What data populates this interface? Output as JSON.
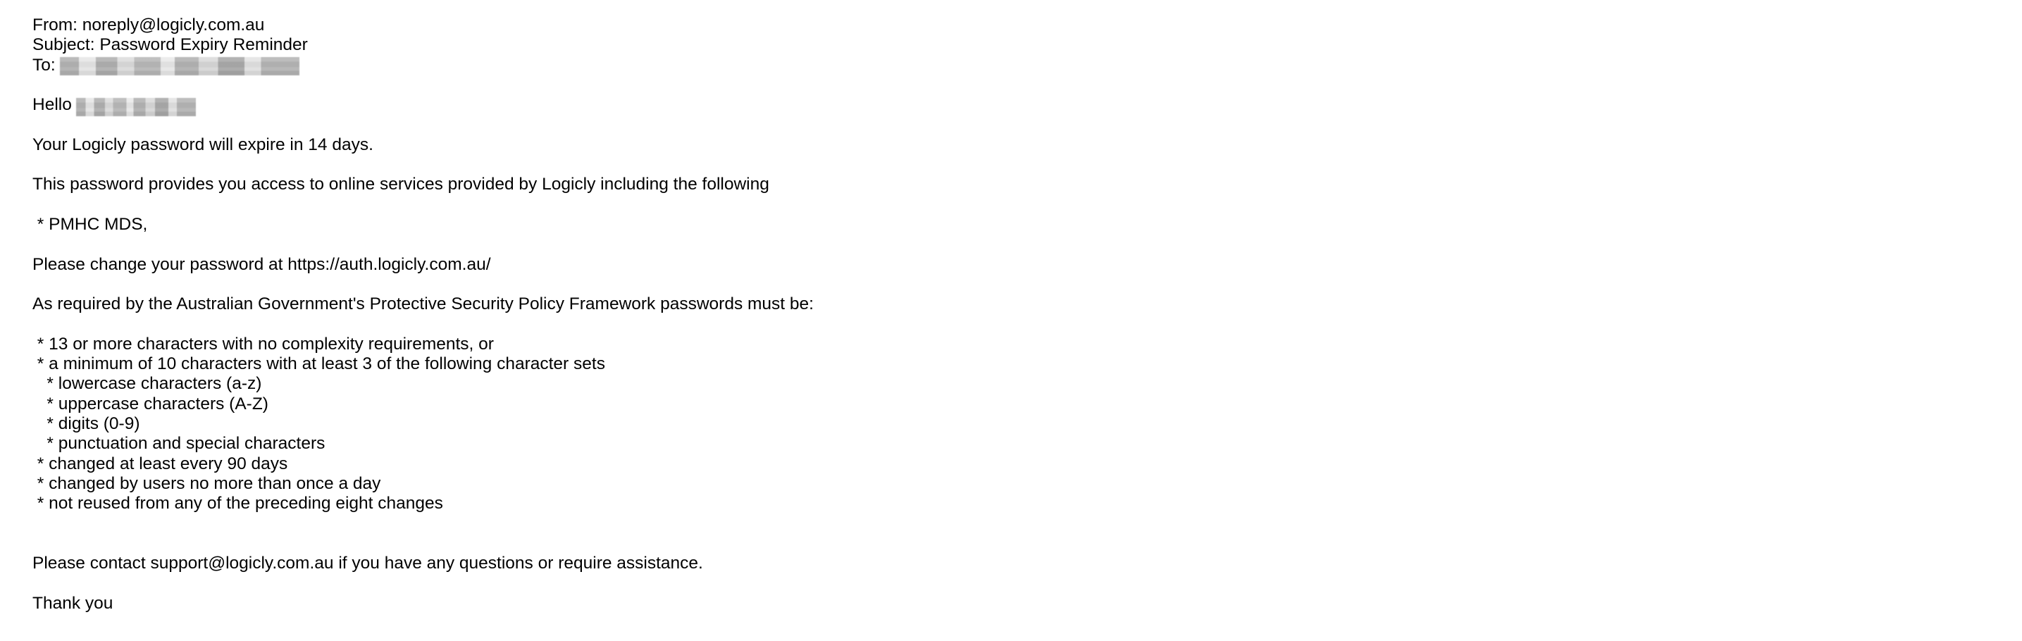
{
  "header": {
    "from": "From: noreply@logicly.com.au",
    "subject": "Subject: Password Expiry Reminder",
    "to_label": "To:"
  },
  "body": {
    "greeting": "Hello",
    "expiry_notice": "Your Logicly password will expire in 14 days.",
    "access_intro": "This password provides you access to online services provided by Logicly including the following",
    "services": [
      " * PMHC MDS,"
    ],
    "change_instruction": "Please change your password at https://auth.logicly.com.au/",
    "requirements_intro": "As required by the Australian Government's Protective Security Policy Framework passwords must be:",
    "requirements": [
      " * 13 or more characters with no complexity requirements, or",
      " * a minimum of 10 characters with at least 3 of the following character sets",
      "   * lowercase characters (a-z)",
      "   * uppercase characters (A-Z)",
      "   * digits (0-9)",
      "   * punctuation and special characters",
      " * changed at least every 90 days",
      " * changed by users no more than once a day",
      " * not reused from any of the preceding eight changes"
    ],
    "contact": "Please contact support@logicly.com.au if you have any questions or require assistance.",
    "closing": "Thank you"
  }
}
